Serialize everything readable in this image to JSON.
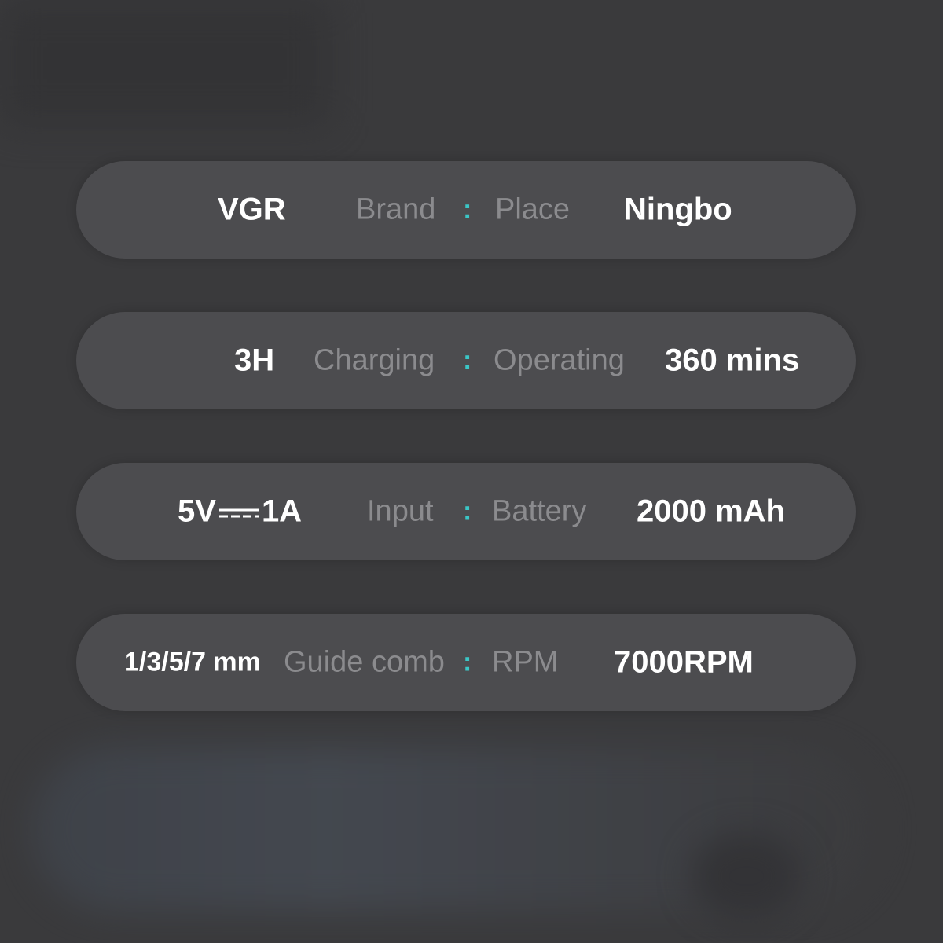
{
  "specs": [
    {
      "value_left": "VGR",
      "label_left": "Brand",
      "separator": ":",
      "label_right": "Place",
      "value_right": "Ningbo"
    },
    {
      "value_left": "3H",
      "label_left": "Charging",
      "separator": ":",
      "label_right": "Operating",
      "value_right": "360 mins"
    },
    {
      "value_left_pre": "5V",
      "value_left_post": "1A",
      "dc_icon": "direct-current-symbol",
      "label_left": "Input",
      "separator": ":",
      "label_right": "Battery",
      "value_right": "2000 mAh"
    },
    {
      "value_left": "1/3/5/7 mm",
      "label_left": "Guide comb",
      "separator": ":",
      "label_right": "RPM",
      "value_right": "7000RPM"
    }
  ],
  "colors": {
    "background": "#3a3a3c",
    "pill": "#4c4c4f",
    "value_text": "#ffffff",
    "label_text": "#8b8b8e",
    "separator": "#3bc6c6"
  }
}
